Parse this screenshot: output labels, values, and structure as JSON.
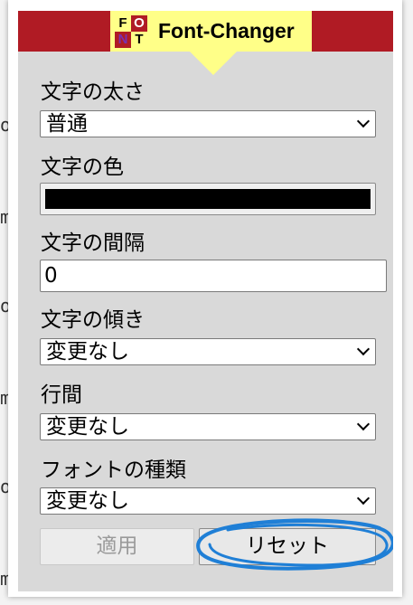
{
  "header": {
    "title": "Font-Changer",
    "logo_letters": [
      "F",
      "O",
      "N",
      "T"
    ]
  },
  "fields": {
    "weight": {
      "label": "文字の太さ",
      "value": "普通"
    },
    "color": {
      "label": "文字の色",
      "value": "#000000"
    },
    "spacing": {
      "label": "文字の間隔",
      "value": "0"
    },
    "slant": {
      "label": "文字の傾き",
      "value": "変更なし"
    },
    "line_height": {
      "label": "行間",
      "value": "変更なし"
    },
    "font_family": {
      "label": "フォントの種類",
      "value": "変更なし"
    }
  },
  "buttons": {
    "apply": "適用",
    "reset": "リセット"
  },
  "background_fragments": [
    "o",
    "m",
    "o",
    "m",
    "o",
    "m"
  ],
  "colors": {
    "header_red": "#b01b24",
    "title_yellow": "#ffff88",
    "panel_gray": "#d9d9d9",
    "annotation_blue": "#1f7fd6"
  }
}
